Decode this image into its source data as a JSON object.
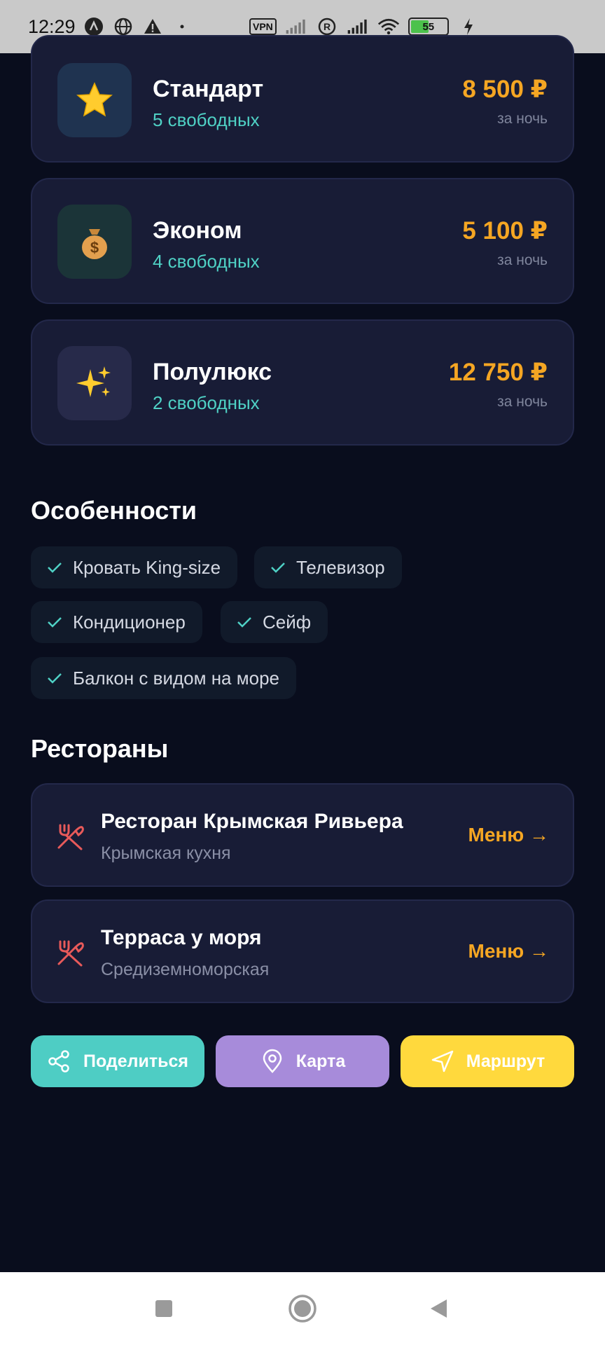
{
  "status_bar": {
    "time": "12:29",
    "vpn_label": "VPN",
    "battery_level": "55",
    "battery_fraction": 0.55,
    "icons": [
      "android-icon",
      "globe-icon",
      "warning-icon",
      "dot-icon",
      "vpn-icon",
      "signal-icon",
      "roaming-icon",
      "signal-icon",
      "wifi-icon",
      "battery-icon",
      "charging-icon"
    ]
  },
  "rooms": [
    {
      "name": "Стандарт",
      "available": "5 свободных",
      "price": "8 500 ₽",
      "unit": "за ночь",
      "icon": "star-icon",
      "icon_bg": "#1f3350"
    },
    {
      "name": "Эконом",
      "available": "4 свободных",
      "price": "5 100 ₽",
      "unit": "за ночь",
      "icon": "money-bag-icon",
      "icon_bg": "#1b3438"
    },
    {
      "name": "Полулюкс",
      "available": "2 свободных",
      "price": "12 750 ₽",
      "unit": "за ночь",
      "icon": "sparkles-icon",
      "icon_bg": "#272a4a"
    }
  ],
  "features": {
    "title": "Особенности",
    "items": [
      "Кровать King-size",
      "Телевизор",
      "Кондиционер",
      "Сейф",
      "Балкон с видом на море"
    ]
  },
  "restaurants": {
    "title": "Рестораны",
    "items": [
      {
        "name": "Ресторан Крымская Ривьера",
        "cuisine": "Крымская кухня",
        "menu_label": "Меню →"
      },
      {
        "name": "Терраса у моря",
        "cuisine": "Средиземноморская",
        "menu_label": "Меню →"
      }
    ]
  },
  "actions": {
    "share_label": "Поделиться",
    "map_label": "Карта",
    "route_label": "Маршрут",
    "colors": {
      "share": "#4ecdc4",
      "map": "#a78bda",
      "route": "#ffd93d"
    }
  },
  "colors": {
    "background": "#090d1d",
    "card": "#181c36",
    "accent_price": "#f5a623",
    "accent_teal": "#4fd1c5"
  }
}
